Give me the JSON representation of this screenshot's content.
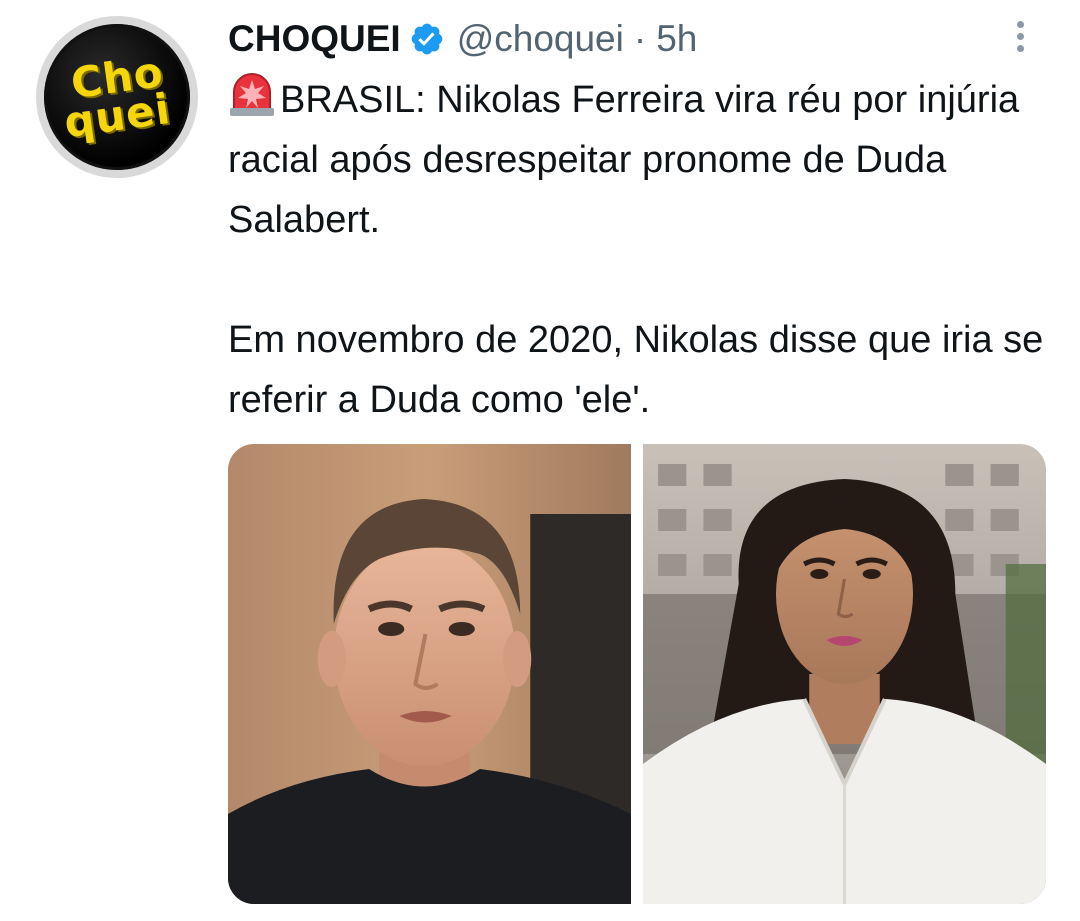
{
  "tweet": {
    "author": {
      "display_name": "CHOQUEI",
      "handle": "@choquei",
      "verified": true,
      "avatar": {
        "line1": "Cho",
        "line2": "quei",
        "colors": {
          "text": "#f5d60a",
          "background": "#000000",
          "ring": "#d9d9d9"
        }
      }
    },
    "separator": "·",
    "time": "5h",
    "text": {
      "emoji": "rotating-light-icon",
      "paragraph1": "BRASIL: Nikolas Ferreira vira réu por injúria racial após desrespeitar pronome de Duda Salabert.",
      "paragraph2": "Em novembro de 2020, Nikolas disse que iria se referir a Duda como 'ele'."
    },
    "media": [
      {
        "name": "photo-nikolas-ferreira",
        "icon": "photo-man-dark-shirt"
      },
      {
        "name": "photo-duda-salabert",
        "icon": "photo-woman-white-shirt"
      }
    ],
    "colors": {
      "text": "#0f1419",
      "secondary": "#536471",
      "verified_badge": "#1d9bf0"
    }
  }
}
